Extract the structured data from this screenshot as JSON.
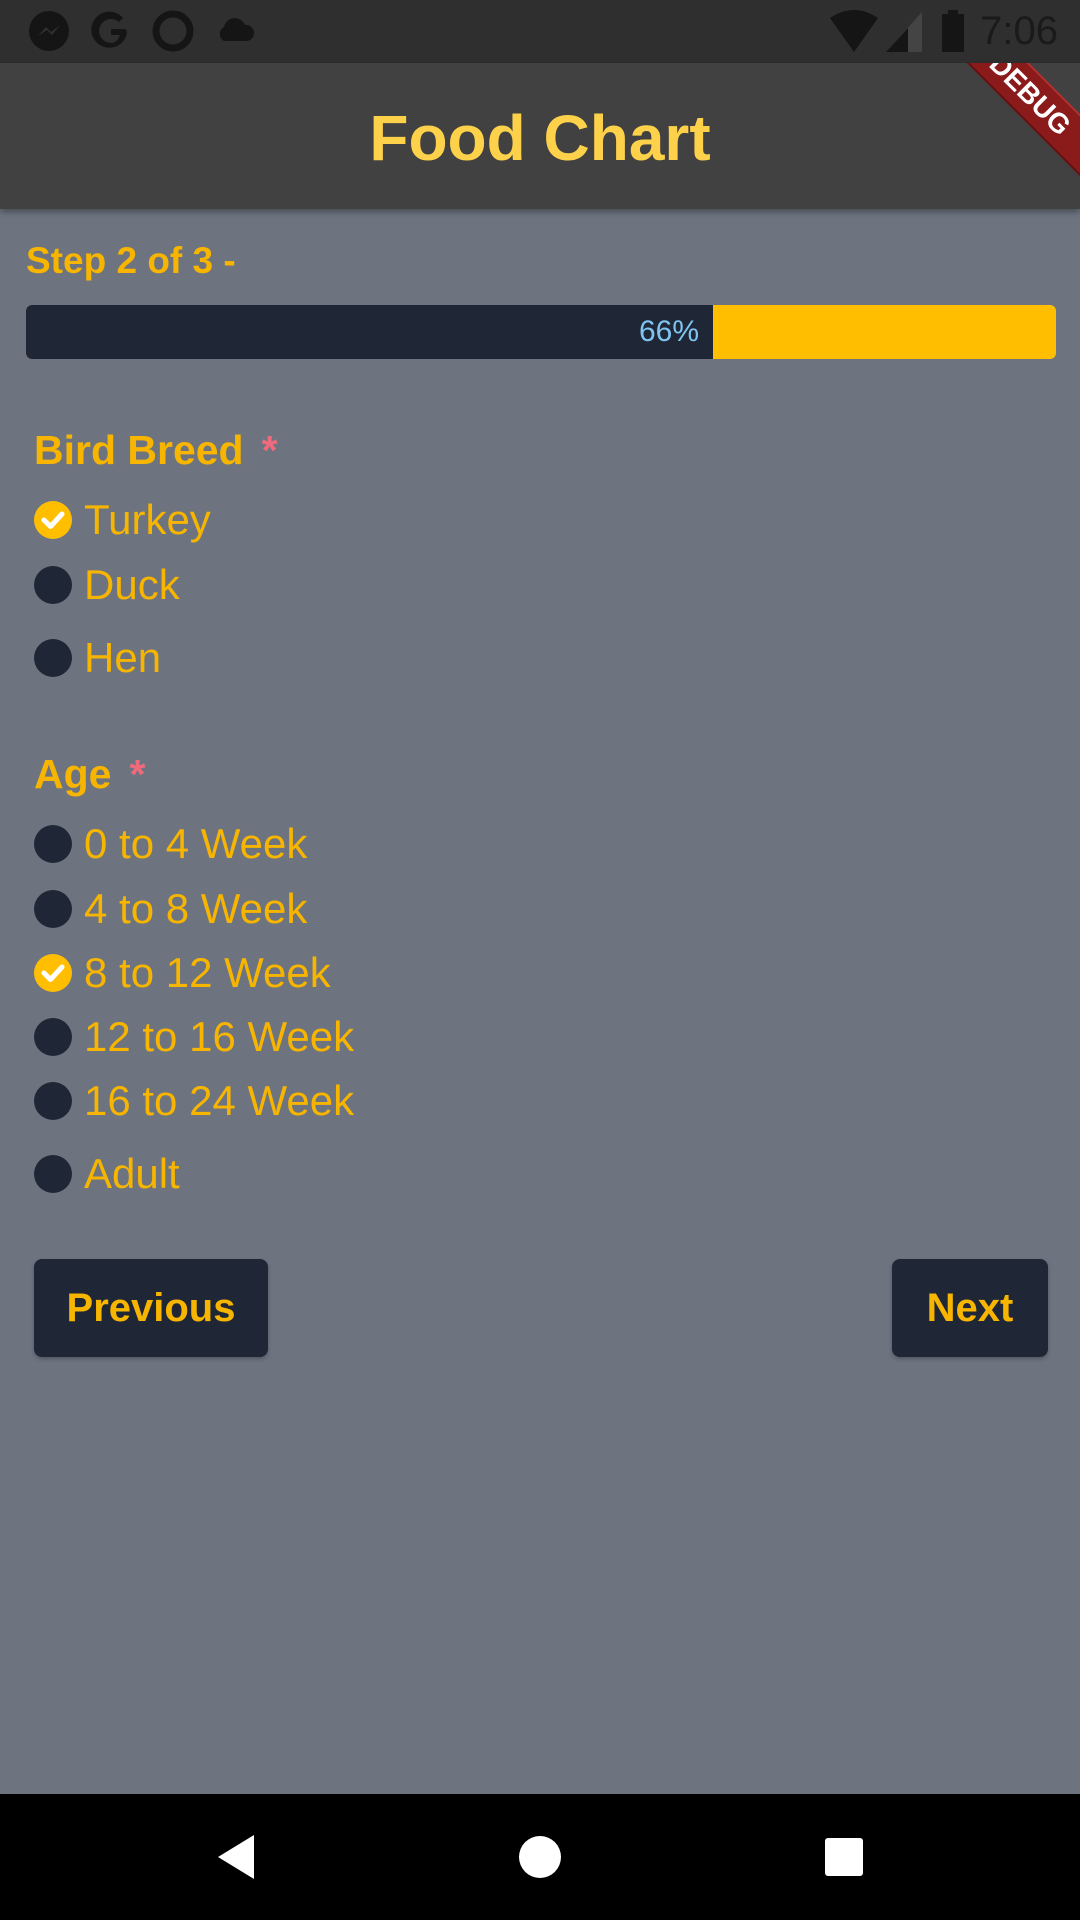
{
  "status_bar": {
    "time": "7:06",
    "left_icons": [
      "messenger-icon",
      "google-icon",
      "circle-app-icon",
      "cloud-icon"
    ],
    "right_icons": [
      "wifi-icon",
      "signal-icon",
      "battery-icon"
    ]
  },
  "app_bar": {
    "title": "Food Chart",
    "debug_banner": "DEBUG"
  },
  "stepper": {
    "step_label": "Step 2 of 3 -",
    "progress_text": "66%",
    "progress_value": 0.667
  },
  "bird_breed": {
    "title": "Bird Breed",
    "required_mark": "*",
    "options": [
      {
        "label": "Turkey",
        "checked": true
      },
      {
        "label": "Duck",
        "checked": false
      },
      {
        "label": "Hen",
        "checked": false
      }
    ]
  },
  "age": {
    "title": "Age",
    "required_mark": "*",
    "options": [
      {
        "label": "0 to 4 Week",
        "checked": false
      },
      {
        "label": "4 to 8 Week",
        "checked": false
      },
      {
        "label": "8 to 12 Week",
        "checked": true
      },
      {
        "label": "12 to 16 Week",
        "checked": false
      },
      {
        "label": "16 to 24 Week",
        "checked": false
      },
      {
        "label": "Adult",
        "checked": false
      }
    ]
  },
  "buttons": {
    "previous_label": "Previous",
    "next_label": "Next"
  },
  "colors": {
    "accent": "#ffbf00",
    "background": "#6d7480",
    "dark": "#1f2736",
    "required": "#ee6a7d"
  },
  "nav_bar": {
    "icons": [
      "back-icon",
      "home-icon",
      "recents-icon"
    ]
  }
}
